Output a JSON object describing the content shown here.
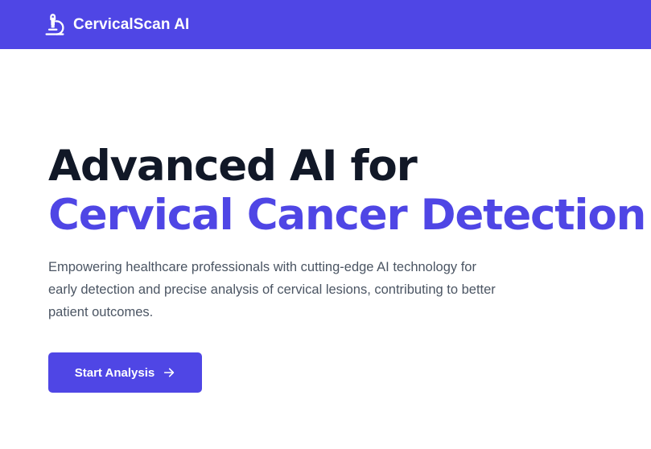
{
  "nav": {
    "brand_name": "CervicalScan AI",
    "brand_icon": "microscope-icon",
    "background": "#4f46e5"
  },
  "hero": {
    "headline_line1": "Advanced AI for",
    "headline_line2": "Cervical Cancer Detection",
    "description": "Empowering healthcare professionals with cutting-edge AI technology for early detection and precise analysis of cervical lesions, contributing to better patient outcomes.",
    "cta_label": "Start Analysis",
    "cta_icon": "arrow-right-icon"
  },
  "colors": {
    "accent": "#4f46e5",
    "heading_dark": "#111827",
    "body_text": "#4b5563"
  }
}
